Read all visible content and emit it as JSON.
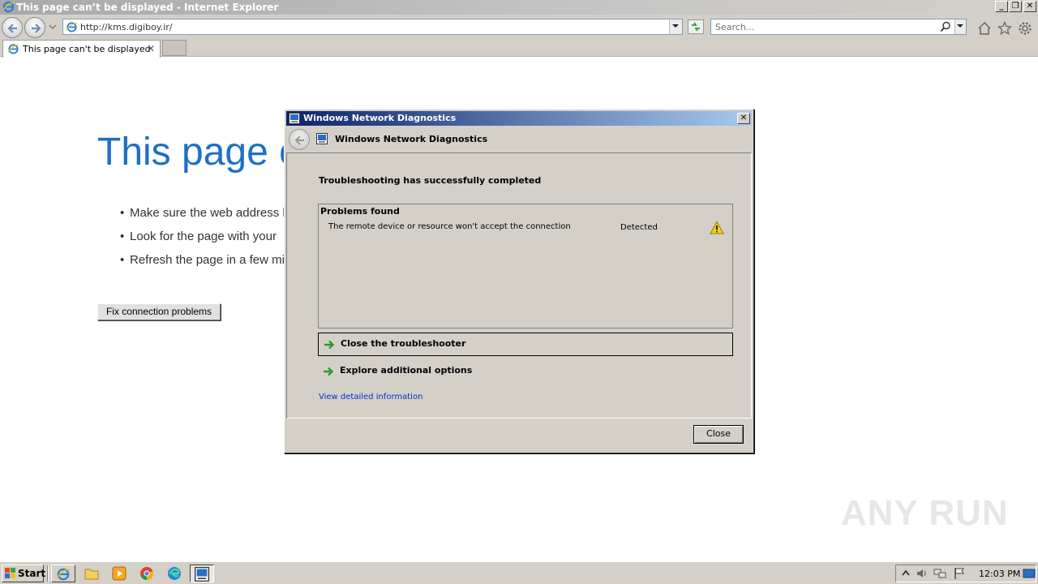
{
  "browser": {
    "window_title": "This page can’t be displayed - Internet Explorer",
    "address_url": "http://kms.digiboy.ir/",
    "search_placeholder": "Search...",
    "tab_label": "This page can't be displayed",
    "tab_close_glyph": "✕"
  },
  "window_controls": {
    "minimize": "_",
    "restore": "❐",
    "close": "✕"
  },
  "page": {
    "heading": "This page c",
    "suggestions": [
      "Make sure the web address h",
      "Look for the page with your",
      "Refresh the page in a few mi"
    ],
    "fix_button": "Fix connection problems"
  },
  "dialog": {
    "title": "Windows Network Diagnostics",
    "header_title": "Windows Network Diagnostics",
    "status": "Troubleshooting has successfully completed",
    "problems_title": "Problems found",
    "problems": [
      {
        "text": "The remote device or resource won't accept the connection",
        "status": "Detected",
        "icon": "warning-icon"
      }
    ],
    "options": [
      {
        "label": "Close the troubleshooter",
        "icon": "green-arrow-icon"
      },
      {
        "label": "Explore additional options",
        "icon": "green-arrow-icon"
      }
    ],
    "detail_link": "View detailed information",
    "close_button": "Close",
    "close_glyph": "✕"
  },
  "taskbar": {
    "start_label": "Start",
    "clock": "12:03 PM",
    "icons": [
      "ie-icon",
      "folder-icon",
      "media-player-icon",
      "chrome-icon",
      "edge-icon",
      "network-diagnostics-icon"
    ]
  },
  "watermark": {
    "text": "ANY RUN"
  },
  "colors": {
    "heading_blue": "#1e6fc7",
    "dialog_title_start": "#0a246a",
    "dialog_title_end": "#a6caf0",
    "link_blue": "#0033cc"
  }
}
